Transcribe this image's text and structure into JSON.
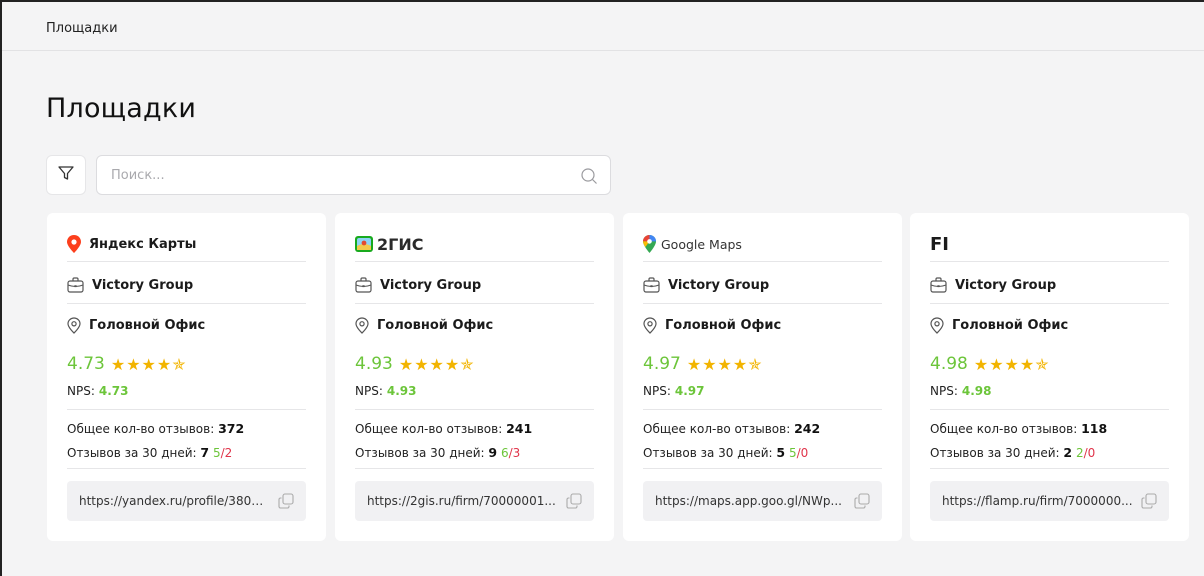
{
  "breadcrumb": "Площадки",
  "page_title": "Площадки",
  "search": {
    "placeholder": "Поиск..."
  },
  "labels": {
    "nps": "NPS:",
    "total_reviews": "Общее кол-во отзывов:",
    "reviews_30_days": "Отзывов за 30 дней:"
  },
  "colors": {
    "positive": "#6cc53a",
    "negative": "#e0344a",
    "stars": "#f2b400"
  },
  "cards": [
    {
      "platform": "Яндекс Карты",
      "logo_icon": "yandex-maps-pin-icon",
      "company": "Victory Group",
      "office": "Головной Офис",
      "rating": "4.73",
      "stars": "★★★★✯",
      "nps": "4.73",
      "total_reviews": "372",
      "reviews_30": "7",
      "reviews_30_pos": "5",
      "reviews_30_neg": "2",
      "url": "https://yandex.ru/profile/3806..."
    },
    {
      "platform": "2ГИС",
      "logo_icon": "2gis-logo-icon",
      "company": "Victory Group",
      "office": "Головной Офис",
      "rating": "4.93",
      "stars": "★★★★✯",
      "nps": "4.93",
      "total_reviews": "241",
      "reviews_30": "9",
      "reviews_30_pos": "6",
      "reviews_30_neg": "3",
      "url": "https://2gis.ru/firm/70000001..."
    },
    {
      "platform": "Google Maps",
      "logo_icon": "google-maps-pin-icon",
      "company": "Victory Group",
      "office": "Головной Офис",
      "rating": "4.97",
      "stars": "★★★★✯",
      "nps": "4.97",
      "total_reviews": "242",
      "reviews_30": "5",
      "reviews_30_pos": "5",
      "reviews_30_neg": "0",
      "url": "https://maps.app.goo.gl/NWp..."
    },
    {
      "platform": "FI",
      "logo_icon": "flamp-logo-icon",
      "company": "Victory Group",
      "office": "Головной Офис",
      "rating": "4.98",
      "stars": "★★★★✯",
      "nps": "4.98",
      "total_reviews": "118",
      "reviews_30": "2",
      "reviews_30_pos": "2",
      "reviews_30_neg": "0",
      "url": "https://flamp.ru/firm/7000000..."
    }
  ]
}
